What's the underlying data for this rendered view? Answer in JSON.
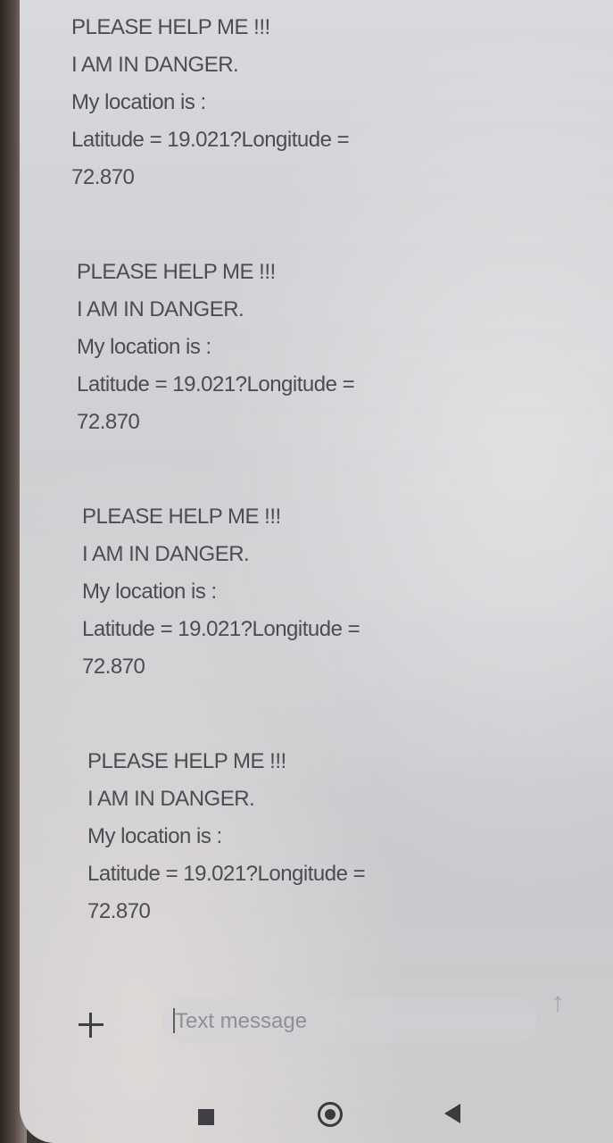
{
  "messages": [
    {
      "line1": "PLEASE HELP ME !!!",
      "line2": "I AM IN DANGER.",
      "line3": "My location is :",
      "line4": "Latitude = 19.021?Longitude =",
      "line5": "72.870"
    },
    {
      "line1": "PLEASE HELP ME !!!",
      "line2": "I AM IN DANGER.",
      "line3": "My location is :",
      "line4": "Latitude = 19.021?Longitude =",
      "line5": "72.870"
    },
    {
      "line1": "PLEASE HELP ME !!!",
      "line2": "I AM IN DANGER.",
      "line3": "My location is :",
      "line4": "Latitude = 19.021?Longitude =",
      "line5": "72.870"
    },
    {
      "line1": "PLEASE HELP ME !!!",
      "line2": "I AM IN DANGER.",
      "line3": "My location is :",
      "line4": "Latitude = 19.021?Longitude =",
      "line5": "72.870"
    }
  ],
  "composer": {
    "placeholder": "Text message",
    "add_icon": "plus-icon",
    "send_icon": "send-arrow-icon"
  },
  "navbar": {
    "recent_icon": "recent-apps-icon",
    "home_icon": "home-icon",
    "back_icon": "back-icon"
  },
  "colors": {
    "text": "#4a4d52",
    "background": "#cfd0d3"
  }
}
